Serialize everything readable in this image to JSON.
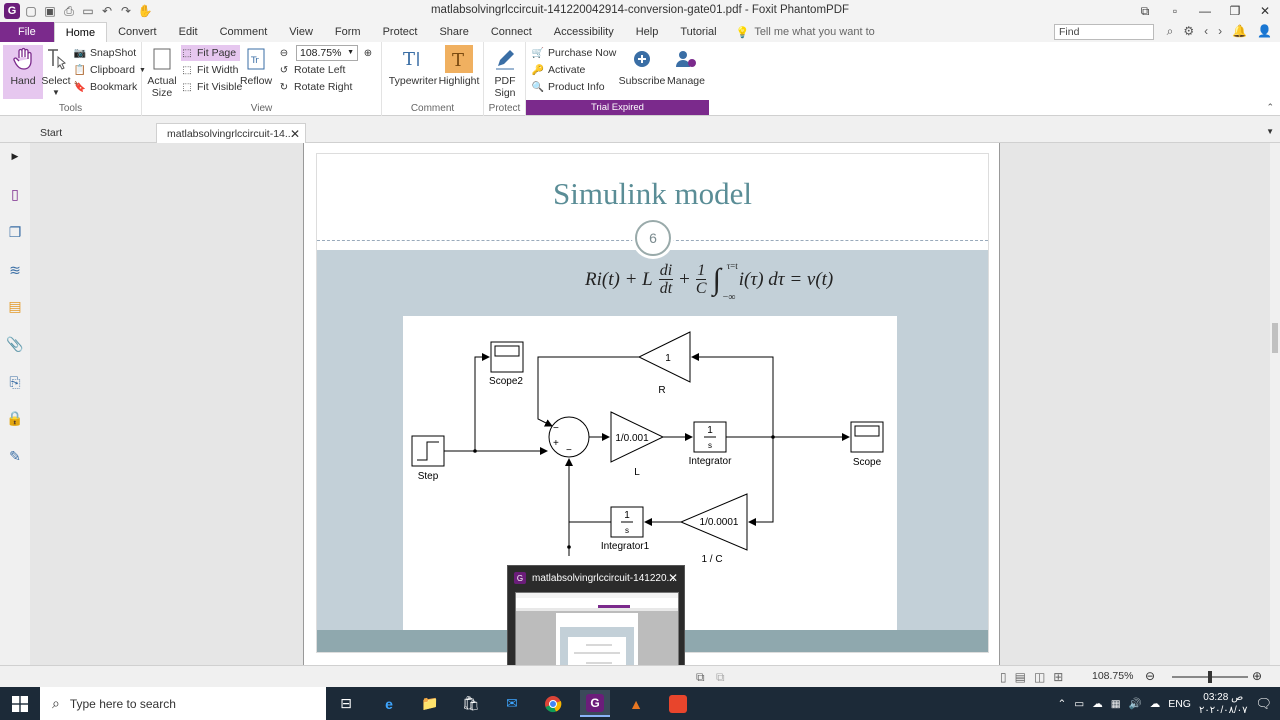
{
  "window": {
    "title": "matlabsolvingrlccircuit-141220042914-conversion-gate01.pdf - Foxit PhantomPDF"
  },
  "ribbon_tabs": [
    {
      "label": "File"
    },
    {
      "label": "Home"
    },
    {
      "label": "Convert"
    },
    {
      "label": "Edit"
    },
    {
      "label": "Comment"
    },
    {
      "label": "View"
    },
    {
      "label": "Form"
    },
    {
      "label": "Protect"
    },
    {
      "label": "Share"
    },
    {
      "label": "Connect"
    },
    {
      "label": "Accessibility"
    },
    {
      "label": "Help"
    },
    {
      "label": "Tutorial"
    }
  ],
  "tell_me": "Tell me what you want to",
  "find_placeholder": "Find",
  "ribbon": {
    "hand": "Hand",
    "select": "Select",
    "snapshot": "SnapShot",
    "clipboard": "Clipboard",
    "bookmark": "Bookmark",
    "tools_label": "Tools",
    "actual_size": "Actual Size",
    "fit_page": "Fit Page",
    "fit_width": "Fit Width",
    "fit_visible": "Fit Visible",
    "reflow": "Reflow",
    "zoom_value": "108.75%",
    "rotate_left": "Rotate Left",
    "rotate_right": "Rotate Right",
    "view_label": "View",
    "typewriter": "Typewriter",
    "highlight": "Highlight",
    "comment_label": "Comment",
    "pdf_sign": "PDF Sign",
    "protect_label": "Protect",
    "purchase_now": "Purchase Now",
    "activate": "Activate",
    "product_info": "Product Info",
    "subscribe": "Subscribe",
    "manage": "Manage",
    "trial_expired": "Trial Expired"
  },
  "doc_tabs": [
    {
      "label": "Start"
    },
    {
      "label": "matlabsolvingrlccircuit-14..."
    }
  ],
  "slide": {
    "title": "Simulink model",
    "number": "6",
    "eq": {
      "lhs1": "Ri(t) + L",
      "frac1_num": "di",
      "frac1_den": "dt",
      "plus": "+",
      "frac2_num": "1",
      "frac2_den": "C",
      "int_upper": "τ=t",
      "int_lower": "−∞",
      "rhs": "i(τ) dτ = v(t)"
    },
    "blocks": {
      "scope2": "Scope2",
      "r_gain": "1",
      "r_label": "R",
      "l_gain": "1/0.001",
      "l_label": "L",
      "int_num": "1",
      "int_den": "s",
      "integrator": "Integrator",
      "scope": "Scope",
      "step": "Step",
      "c_gain": "1/0.0001",
      "c_label": "1 / C",
      "integrator1": "Integrator1",
      "minus": "−",
      "plus": "+"
    }
  },
  "thumbnail_popup": {
    "title": "matlabsolvingrlccircuit-141220..."
  },
  "status": {
    "zoom": "108.75%"
  },
  "taskbar": {
    "search_placeholder": "Type here to search",
    "lang": "ENG",
    "time": "03:28 ص",
    "date": "٢٠٢٠/٠٨/٠٧"
  }
}
